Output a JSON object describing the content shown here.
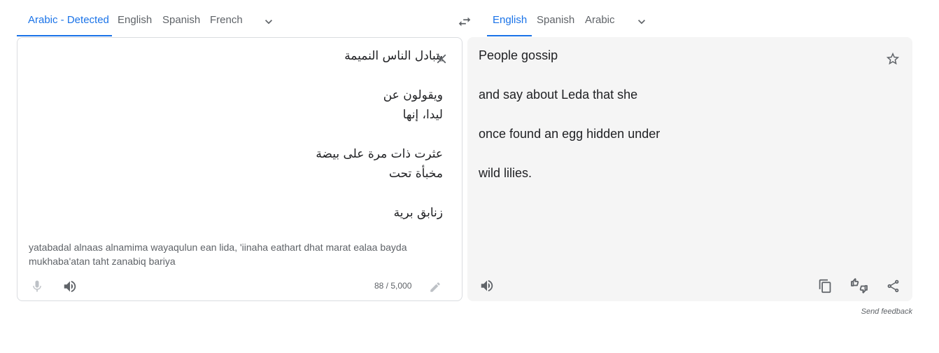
{
  "source_languages": [
    {
      "label": "Arabic - Detected",
      "active": true
    },
    {
      "label": "English",
      "active": false
    },
    {
      "label": "Spanish",
      "active": false
    },
    {
      "label": "French",
      "active": false
    }
  ],
  "target_languages": [
    {
      "label": "English",
      "active": true
    },
    {
      "label": "Spanish",
      "active": false
    },
    {
      "label": "Arabic",
      "active": false
    }
  ],
  "source": {
    "lines": [
      "يتبادل الناس النميمة",
      "",
      "ويقولون عن",
      "ليدا، إنها",
      "",
      "عثرت ذات مرة على بيضة",
      "مخبأة تحت",
      "",
      "زنابق برية"
    ],
    "transliteration": "yatabadal alnaas alnamima wayaqulun ean lida, 'iinaha eathart dhat marat ealaa bayda mukhaba'atan taht zanabiq bariya",
    "char_count": "88 / 5,000"
  },
  "target": {
    "lines": [
      "People gossip",
      "",
      "and say about Leda that she",
      "",
      "once found an egg hidden under",
      "",
      "wild lilies."
    ]
  },
  "footer": {
    "send_feedback": "Send feedback"
  },
  "colors": {
    "accent": "#1a73e8",
    "muted": "#5f6368",
    "target_bg": "#f5f5f5",
    "border": "#dadce0"
  }
}
